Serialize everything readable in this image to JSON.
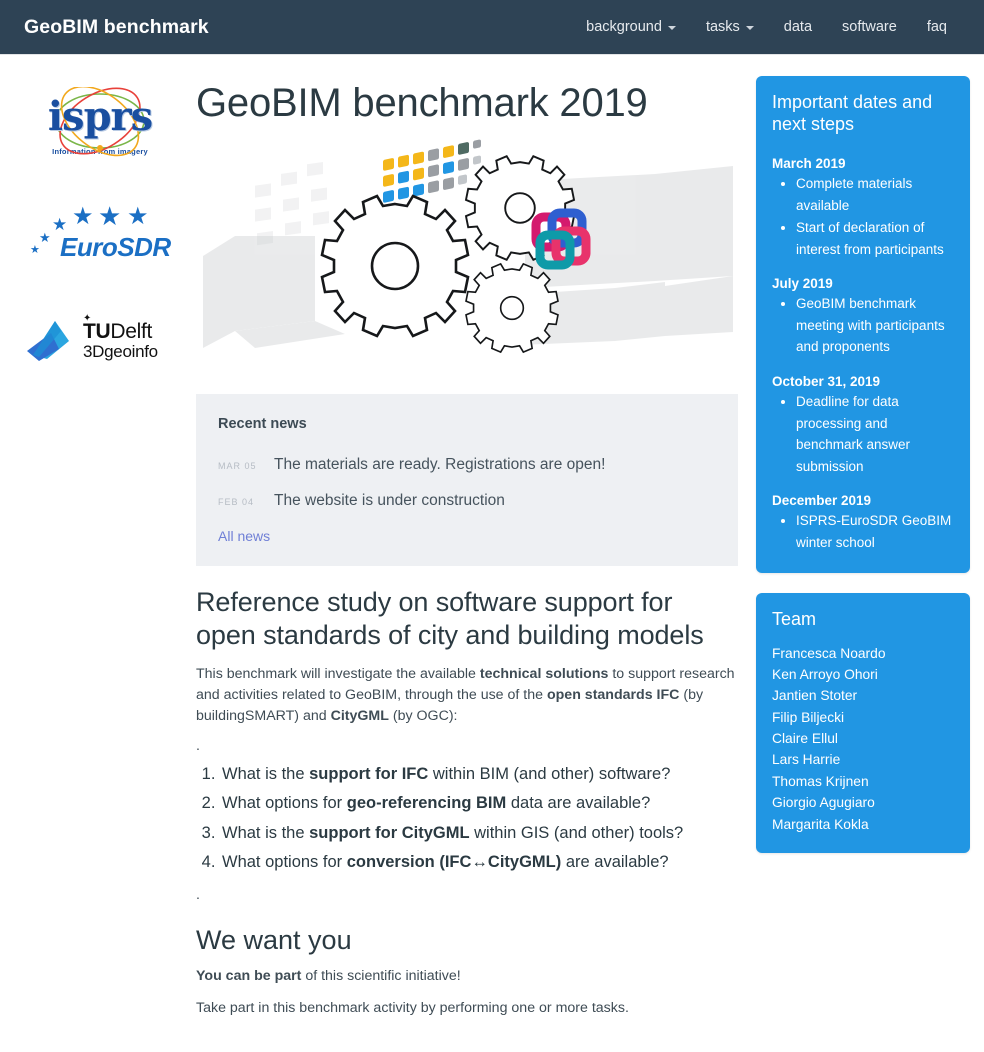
{
  "navbar": {
    "brand": "GeoBIM benchmark",
    "links": [
      {
        "label": "background",
        "has_caret": true
      },
      {
        "label": "tasks",
        "has_caret": true
      },
      {
        "label": "data",
        "has_caret": false
      },
      {
        "label": "software",
        "has_caret": false
      },
      {
        "label": "faq",
        "has_caret": false
      }
    ]
  },
  "logos": {
    "isprs": {
      "name": "isprs",
      "tagline": "Information from imagery"
    },
    "eurosdr": {
      "name": "EuroSDR"
    },
    "tudelft": {
      "line1_bold": "TU",
      "line1_rest": "Delft",
      "line2": "3Dgeoinfo"
    }
  },
  "main": {
    "title": "GeoBIM benchmark 2019",
    "hero_alt": "gears-and-buildings-illustration",
    "news": {
      "heading": "Recent news",
      "items": [
        {
          "date": "Mar 05",
          "text": "The materials are ready. Registrations are open!"
        },
        {
          "date": "Feb 04",
          "text": "The website is under construction"
        }
      ],
      "all_news_label": "All news"
    },
    "section_title": "Reference study on software support for open standards of city and building models",
    "intro_parts": [
      {
        "text": "This benchmark will investigate the available ",
        "bold": false
      },
      {
        "text": "technical solutions",
        "bold": true
      },
      {
        "text": " to support research and activities related to GeoBIM, through the use of the ",
        "bold": false
      },
      {
        "text": "open standards IFC",
        "bold": true
      },
      {
        "text": " (by buildingSMART) and ",
        "bold": false
      },
      {
        "text": "CityGML",
        "bold": true
      },
      {
        "text": " (by OGC):",
        "bold": false
      }
    ],
    "dot": ".",
    "questions": [
      [
        {
          "text": "What is the ",
          "bold": false
        },
        {
          "text": "support for IFC",
          "bold": true
        },
        {
          "text": " within BIM (and other) software?",
          "bold": false
        }
      ],
      [
        {
          "text": "What options for ",
          "bold": false
        },
        {
          "text": "geo-referencing BIM",
          "bold": true
        },
        {
          "text": " data are available?",
          "bold": false
        }
      ],
      [
        {
          "text": "What is the ",
          "bold": false
        },
        {
          "text": "support for CityGML",
          "bold": true
        },
        {
          "text": " within GIS (and other) tools?",
          "bold": false
        }
      ],
      [
        {
          "text": "What options for ",
          "bold": false
        },
        {
          "text": "conversion (IFC↔CityGML)",
          "bold": true
        },
        {
          "text": " are available?",
          "bold": false
        }
      ]
    ],
    "we_want_title": "We want you",
    "we_want_parts": [
      {
        "text": "You can be part",
        "bold": true
      },
      {
        "text": " of this scientific initiative!",
        "bold": false
      }
    ],
    "take_part": "Take part in this benchmark activity by performing one or more tasks."
  },
  "sidebar": {
    "dates_panel": {
      "title": "Important dates and next steps",
      "groups": [
        {
          "label": "March 2019",
          "items": [
            "Complete materials available",
            "Start of declaration of interest from participants"
          ]
        },
        {
          "label": "July 2019",
          "items": [
            "GeoBIM benchmark meeting with participants and proponents"
          ]
        },
        {
          "label": "October 31, 2019",
          "items": [
            "Deadline for data processing and benchmark answer submission"
          ]
        },
        {
          "label": "December 2019",
          "items": [
            "ISPRS-EuroSDR GeoBIM winter school"
          ]
        }
      ]
    },
    "team_panel": {
      "title": "Team",
      "members": [
        "Francesca Noardo",
        "Ken Arroyo Ohori",
        "Jantien Stoter",
        "Filip Biljecki",
        "Claire Ellul",
        "Lars Harrie",
        "Thomas Krijnen",
        "Giorgio Agugiaro",
        "Margarita Kokla"
      ]
    }
  },
  "colors": {
    "navbar_bg": "#2e4355",
    "panel_blue": "#2196e3",
    "news_bg": "#eef0f3",
    "link_blue": "#6f7fd6",
    "text_dark": "#2b3a42",
    "logo_blue": "#1a4fa0"
  }
}
